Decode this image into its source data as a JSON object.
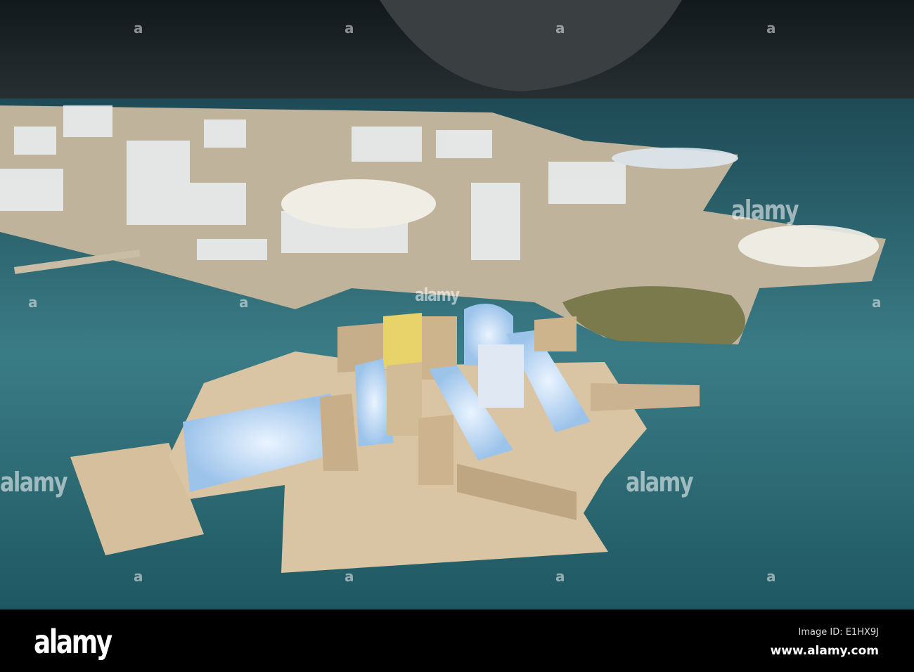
{
  "watermark": {
    "text": "alamy",
    "marker": "a"
  },
  "footer": {
    "logo": "alamy",
    "image_id": "Image ID: E1HX9J",
    "url": "www.alamy.com"
  },
  "colors": {
    "water": "#2f6f78",
    "model": "#d9c4a4",
    "glow": "#cfe3ff",
    "background": "#0b1418"
  }
}
